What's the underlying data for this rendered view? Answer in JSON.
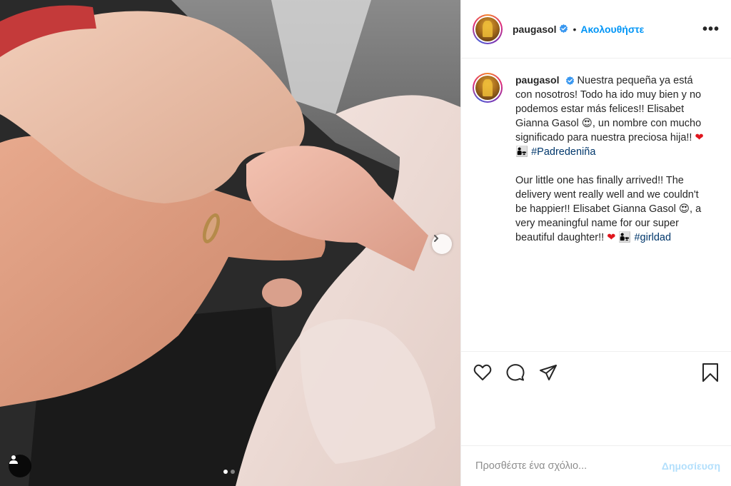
{
  "post": {
    "username": "paugasol",
    "verified": true,
    "follow_label": "Ακολουθήστε",
    "separator": "•",
    "more_label": "•••"
  },
  "caption": {
    "username": "paugasol",
    "spanish_text_1": "Nuestra pequeña ya está con nosotros! Todo ha ido muy bien y no podemos estar más felices!! Elisabet Gianna Gasol ",
    "spanish_emoji_1": "😍",
    "spanish_text_2": ", un nombre con mucho significado para nuestra preciosa hija!! ",
    "spanish_heart": "❤",
    "spanish_family": "👨‍👧",
    "spanish_hashtag": "#Padredeniña",
    "english_text_1": "Our little one has finally arrived!! The delivery went really well and we couldn't be happier!! Elisabet Gianna Gasol ",
    "english_emoji_1": "😍",
    "english_text_2": ", a very meaningful name for our super beautiful daughter!! ",
    "english_heart": "❤",
    "english_family": "👨‍👧",
    "english_hashtag": "#girldad"
  },
  "actions": {
    "icons": [
      "heart-icon",
      "comment-icon",
      "share-icon",
      "bookmark-icon"
    ]
  },
  "comment": {
    "placeholder": "Προσθέστε ένα σχόλιο...",
    "publish_label": "Δημοσίευση"
  },
  "carousel": {
    "current": 1,
    "total": 2
  },
  "colors": {
    "accent_blue": "#0095f6",
    "hashtag": "#00376b",
    "publish_disabled": "#b2dffc",
    "verified_badge": "#3897f0",
    "border": "#efefef"
  }
}
